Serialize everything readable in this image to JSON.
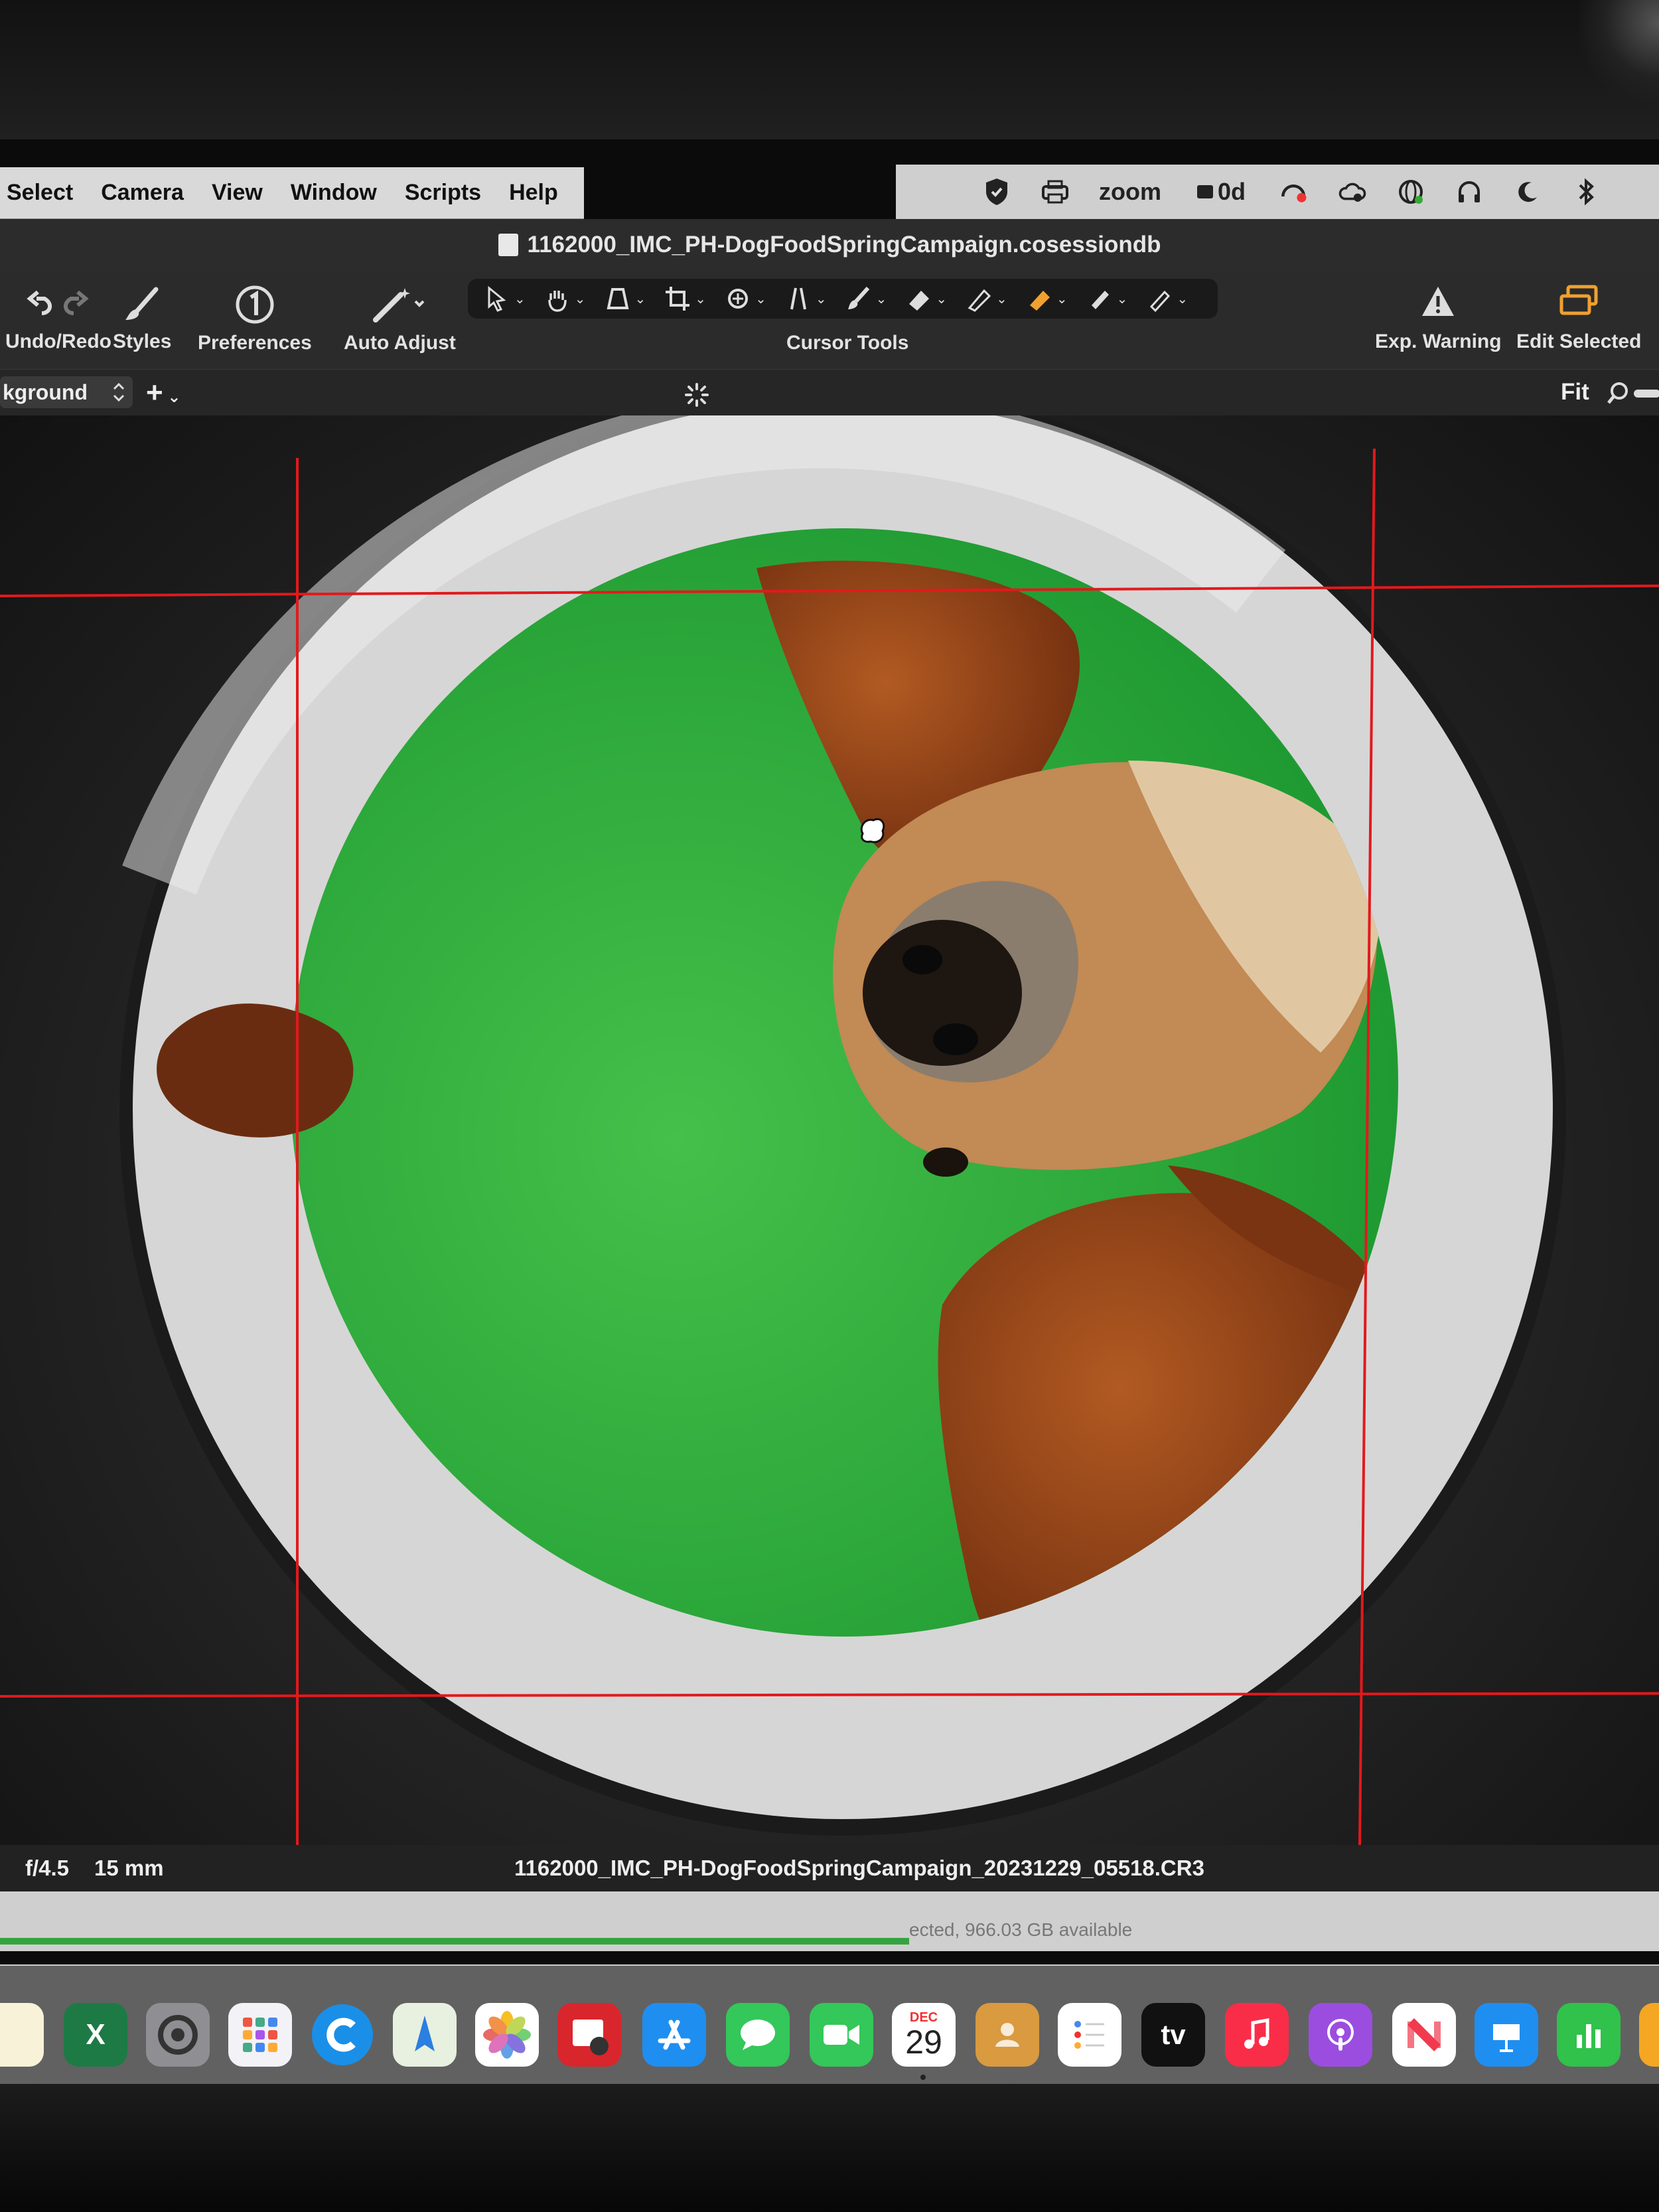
{
  "menubar": {
    "items": [
      "Select",
      "Camera",
      "View",
      "Window",
      "Scripts",
      "Help"
    ]
  },
  "statusbar": {
    "zoom_label": "zoom",
    "timer_label": "0d"
  },
  "window": {
    "title": "1162000_IMC_PH-DogFoodSpringCampaign.cosessiondb"
  },
  "toolbar": {
    "undo_redo_label": "Undo/Redo",
    "styles_label": "Styles",
    "preferences_label": "Preferences",
    "auto_adjust_label": "Auto Adjust",
    "cursor_tools_label": "Cursor Tools",
    "exp_warning_label": "Exp. Warning",
    "edit_selected_label": "Edit Selected",
    "cursor_tools": [
      "select-arrow-icon",
      "hand-pan-icon",
      "loupe-icon",
      "crop-icon",
      "rotate-icon",
      "keystone-icon",
      "brush-icon",
      "eraser-icon",
      "gradient-icon",
      "color-picker-icon",
      "pen-icon",
      "annotate-icon"
    ]
  },
  "subbar": {
    "layer_value": "kground",
    "fit_label": "Fit"
  },
  "infobar": {
    "aperture": "f/4.5",
    "focal_length": "15 mm",
    "filename": "1162000_IMC_PH-DogFoodSpringCampaign_20231229_05518.CR3"
  },
  "finder": {
    "status_text": "ected, 966.03 GB available"
  },
  "dock": {
    "calendar_month": "DEC",
    "calendar_day": "29",
    "tv_label": "tv",
    "apps": [
      "notes",
      "excel",
      "system-settings",
      "launchpad",
      "capture-one",
      "maps",
      "photos",
      "photo-booth",
      "app-store",
      "messages",
      "facetime",
      "calendar",
      "contacts",
      "reminders",
      "apple-tv",
      "music",
      "podcasts",
      "news",
      "keynote",
      "numbers"
    ]
  },
  "colors": {
    "guide_red": "#e2191d",
    "green_screen": "#2fa83a",
    "accent_orange": "#f0a030"
  }
}
